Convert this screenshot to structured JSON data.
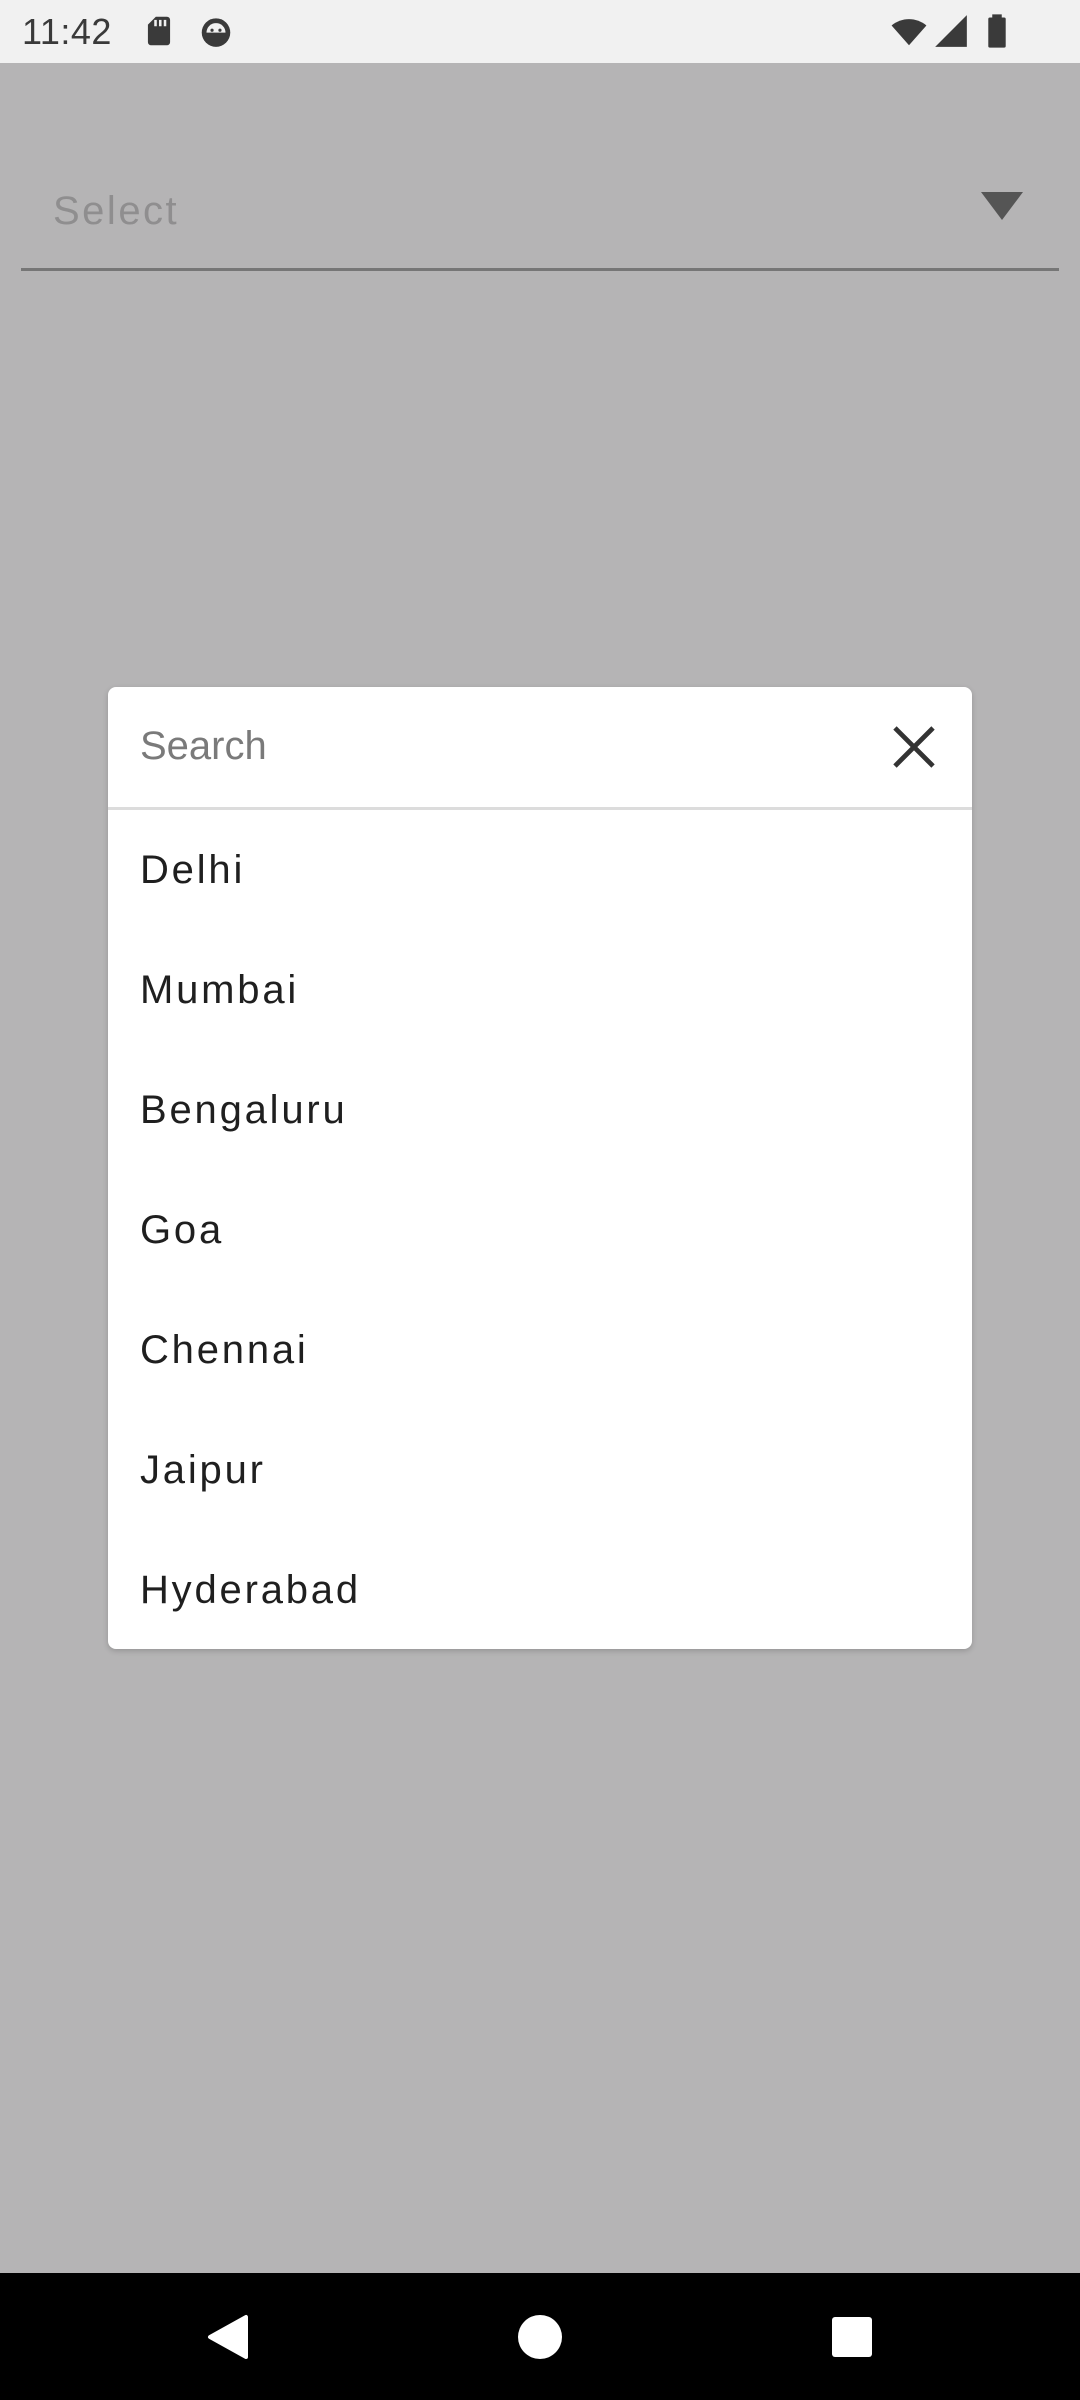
{
  "status_bar": {
    "time": "11:42",
    "left_icons": [
      "sd-card-icon",
      "android-debug-icon"
    ],
    "right_icons": [
      "wifi-icon",
      "cell-signal-icon",
      "battery-icon"
    ]
  },
  "background": {
    "select_field": {
      "label": "Select",
      "icon": "dropdown-arrow-icon"
    }
  },
  "dialog": {
    "search": {
      "placeholder": "Search",
      "value": ""
    },
    "close_icon": "close-icon",
    "items": [
      "Delhi",
      "Mumbai",
      "Bengaluru",
      "Goa",
      "Chennai",
      "Jaipur",
      "Hyderabad"
    ]
  },
  "nav_bar": {
    "icons": [
      "back-icon",
      "home-icon",
      "recents-icon"
    ]
  },
  "colors": {
    "scrim": "#b5b4b5",
    "dialog_bg": "#ffffff",
    "status_bar_bg": "#f1f1f1",
    "nav_bar_bg": "#000000",
    "divider": "#dcdcdc"
  }
}
